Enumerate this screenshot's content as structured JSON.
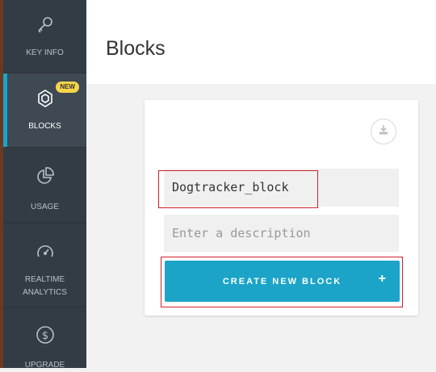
{
  "sidebar": {
    "items": [
      {
        "label": "KEY INFO",
        "icon": "key-icon"
      },
      {
        "label": "BLOCKS",
        "icon": "blocks-icon",
        "badge": "NEW",
        "active": true
      },
      {
        "label": "USAGE",
        "icon": "pie-chart-icon"
      },
      {
        "label": "REALTIME ANALYTICS",
        "icon": "speedometer-icon"
      },
      {
        "label": "UPGRADE",
        "icon": "dollar-icon"
      }
    ]
  },
  "page": {
    "title": "Blocks"
  },
  "form": {
    "name_value": "Dogtracker_block",
    "description_placeholder": "Enter a description",
    "create_label": "CREATE NEW BLOCK",
    "create_icon": "+"
  },
  "colors": {
    "accent": "#1ba4c8",
    "sidebar": "#333c44",
    "badge": "#f6d548",
    "highlight": "#d0202a"
  }
}
